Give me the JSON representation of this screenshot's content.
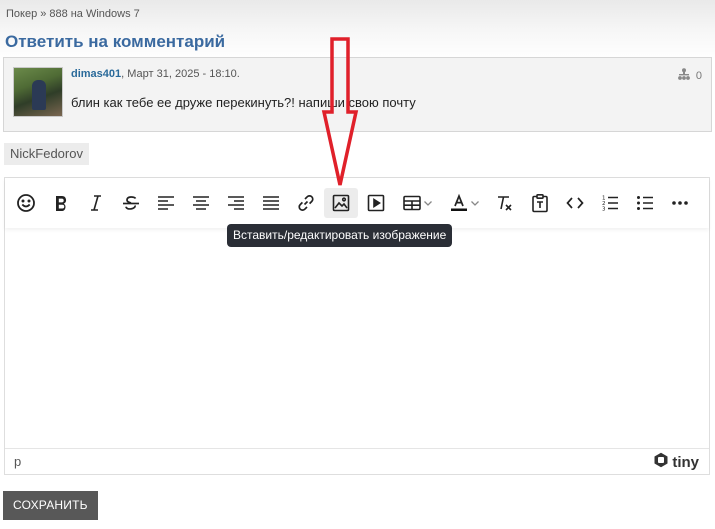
{
  "breadcrumb": {
    "items": [
      "Покер",
      "888 на Windows 7"
    ],
    "separator": "»"
  },
  "page_title": "Ответить на комментарий",
  "comment": {
    "author": "dimas401",
    "date": ", Март 31, 2025 - 18:10.",
    "text": "блин как тебе ее друже перекинуть?! напиши свою почту",
    "reply_count": "0"
  },
  "username": "NickFedorov",
  "editor": {
    "toolbar": [
      {
        "icon": "emoticons-icon",
        "title": "Смайлики"
      },
      {
        "icon": "bold-icon",
        "title": "Жирный"
      },
      {
        "icon": "italic-icon",
        "title": "Курсив"
      },
      {
        "icon": "strikethrough-icon",
        "title": "Зачёркнутый"
      },
      {
        "icon": "align-left-icon",
        "title": "По левому краю"
      },
      {
        "icon": "align-center-icon",
        "title": "По центру"
      },
      {
        "icon": "align-right-icon",
        "title": "По правому краю"
      },
      {
        "icon": "align-justify-icon",
        "title": "По ширине"
      },
      {
        "icon": "link-icon",
        "title": "Ссылка"
      },
      {
        "icon": "image-icon",
        "title": "Вставить/редактировать изображение",
        "active": true
      },
      {
        "icon": "media-icon",
        "title": "Медиа"
      },
      {
        "icon": "table-icon",
        "title": "Таблица"
      },
      {
        "icon": "text-color-icon",
        "title": "Цвет текста"
      },
      {
        "icon": "remove-format-icon",
        "title": "Очистить формат"
      },
      {
        "icon": "paste-text-icon",
        "title": "Вставить как текст"
      },
      {
        "icon": "source-code-icon",
        "title": "Исходный код"
      },
      {
        "icon": "numbered-list-icon",
        "title": "Нумерованный список"
      },
      {
        "icon": "bullet-list-icon",
        "title": "Маркированный список"
      },
      {
        "icon": "more-icon",
        "title": "Ещё"
      }
    ],
    "tooltip": "Вставить/редактировать изображение",
    "status_path": "p",
    "brand": "tiny",
    "content": ""
  },
  "save_label": "СОХРАНИТЬ",
  "colors": {
    "title": "#3b6aa0",
    "author_link": "#2a6a9a",
    "tooltip_bg": "#2a2e36",
    "save_button_bg": "#585858",
    "annotation_arrow": "#e0202a"
  }
}
